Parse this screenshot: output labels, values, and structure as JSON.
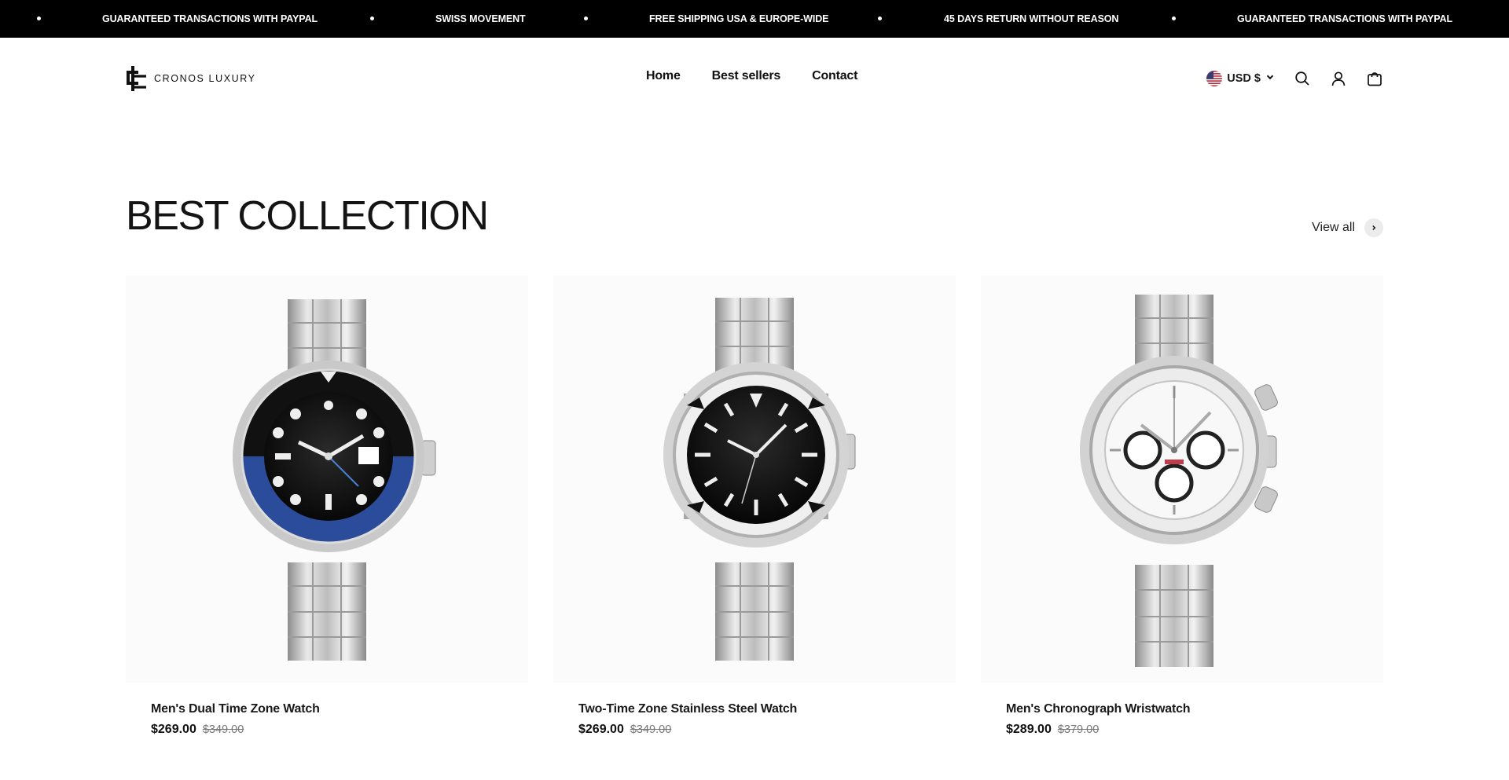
{
  "announcement": {
    "messages": [
      "GUARANTEED TRANSACTIONS WITH PAYPAL",
      "SWISS MOVEMENT",
      "FREE SHIPPING USA & EUROPE-WIDE",
      "45 DAYS RETURN WITHOUT REASON",
      "GUARANTEED TRANSACTIONS WITH PAYPAL"
    ]
  },
  "header": {
    "logo_text": "CRONOS LUXURY",
    "nav": [
      "Home",
      "Best sellers",
      "Contact"
    ],
    "currency": "USD $",
    "icons": [
      "us-flag-icon",
      "chevron-down-icon",
      "search-icon",
      "account-icon",
      "cart-icon"
    ]
  },
  "section": {
    "title": "BEST COLLECTION",
    "view_all": "View all"
  },
  "products": [
    {
      "name": "Men's Dual Time Zone Watch",
      "price": "$269.00",
      "compare_price": "$349.00"
    },
    {
      "name": "Two-Time Zone Stainless Steel Watch",
      "price": "$269.00",
      "compare_price": "$349.00"
    },
    {
      "name": "Men's Chronograph Wristwatch",
      "price": "$289.00",
      "compare_price": "$379.00"
    }
  ],
  "colors": {
    "announcement_bg": "#000000",
    "text": "#1a1a1a",
    "compare_price": "#777777",
    "gmt_bezel_blue": "#2b4c9a"
  }
}
